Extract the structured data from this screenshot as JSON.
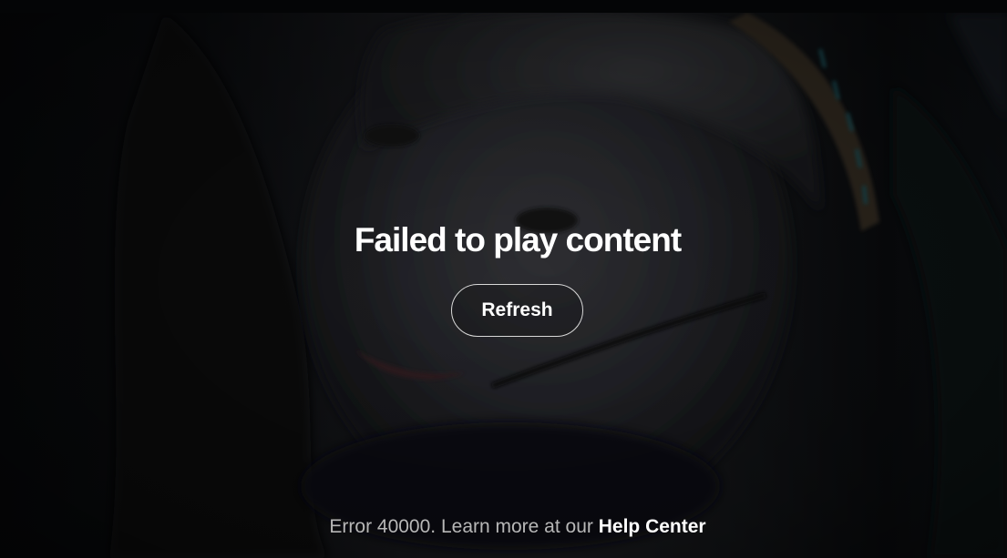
{
  "error": {
    "title": "Failed to play content",
    "refresh_label": "Refresh",
    "message_prefix": "Error 40000. Learn more at our",
    "help_link_label": "Help Center"
  },
  "colors": {
    "title_text": "#ffffff",
    "message_text": "#b7b7b7",
    "button_border": "#d8d8d8",
    "background": "#050607"
  }
}
